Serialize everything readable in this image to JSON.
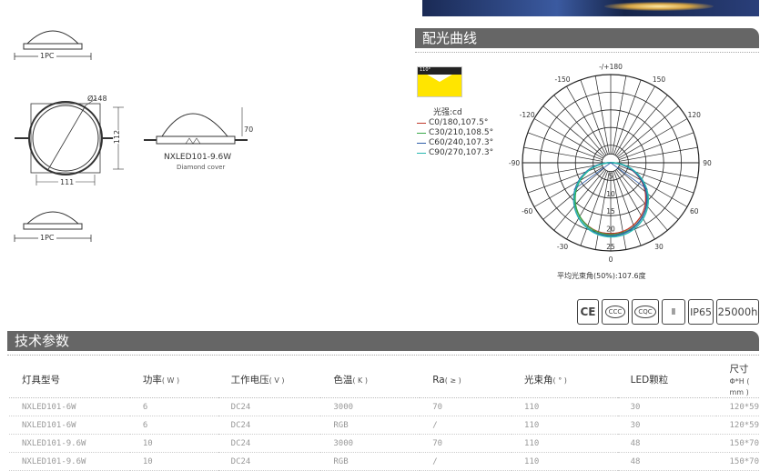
{
  "sections": {
    "light_curve_title": "配光曲线",
    "tech_params_title": "技术参数"
  },
  "dimensions": {
    "pc_label": "1PC",
    "diameter": "Ø148",
    "width": "111",
    "height_side": "112",
    "dome_height": "70",
    "model_caption": "NXLED101-9.6W",
    "cover_caption": "Diamond cover"
  },
  "legend": {
    "title": "光强:cd",
    "entries": [
      {
        "label": "C0/180,107.5°",
        "color": "#c0392b"
      },
      {
        "label": "C30/210,108.5°",
        "color": "#3aa84a"
      },
      {
        "label": "C60/240,107.3°",
        "color": "#2f5ea8"
      },
      {
        "label": "C90/270,107.3°",
        "color": "#27b7b0"
      }
    ],
    "swatch_color": "#ffe500",
    "swatch_label": "110°"
  },
  "polar": {
    "angle_labels": [
      "-/+180",
      "-150",
      "150",
      "-120",
      "120",
      "-90",
      "90",
      "-60",
      "60",
      "-30",
      "30",
      "0"
    ],
    "radial_labels": [
      "5",
      "10",
      "15",
      "20",
      "25"
    ],
    "caption": "平均光束角(50%):107.6度"
  },
  "certifications": [
    "CE",
    "CCC",
    "CQC",
    "Ⅱ",
    "IP65",
    "25000h"
  ],
  "table": {
    "headers": [
      {
        "name": "灯具型号",
        "unit": ""
      },
      {
        "name": "功率",
        "unit": "( W )"
      },
      {
        "name": "工作电压",
        "unit": "( V )"
      },
      {
        "name": "色温",
        "unit": "( K )"
      },
      {
        "name": "Ra",
        "unit": "( ≥ )"
      },
      {
        "name": "光束角",
        "unit": "( ° )"
      },
      {
        "name": "LED颗粒",
        "unit": ""
      },
      {
        "name": "尺寸",
        "unit": "Φ*H ( mm )"
      }
    ],
    "rows": [
      [
        "NXLED101-6W",
        "6",
        "DC24",
        "3000",
        "70",
        "110",
        "30",
        "120*59"
      ],
      [
        "NXLED101-6W",
        "6",
        "DC24",
        "RGB",
        "/",
        "110",
        "30",
        "120*59"
      ],
      [
        "NXLED101-9.6W",
        "10",
        "DC24",
        "3000",
        "70",
        "110",
        "48",
        "150*70"
      ],
      [
        "NXLED101-9.6W",
        "10",
        "DC24",
        "RGB",
        "/",
        "110",
        "48",
        "150*70"
      ]
    ]
  }
}
